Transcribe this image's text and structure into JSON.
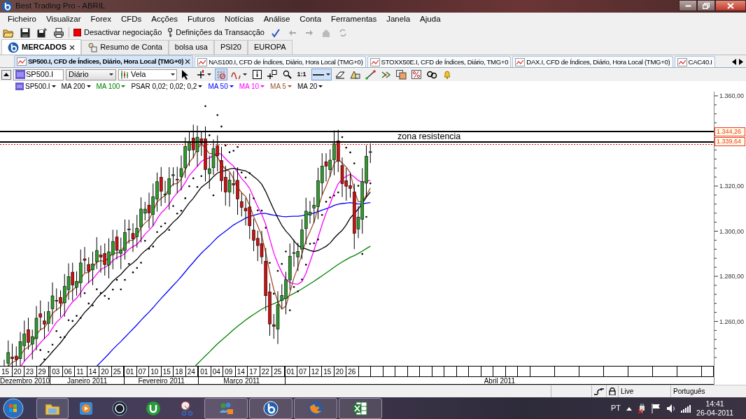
{
  "window": {
    "title": "Best Trading Pro - ABRIL"
  },
  "menu": [
    "Ficheiro",
    "Visualizar",
    "Forex",
    "CFDs",
    "Acções",
    "Futuros",
    "Notícias",
    "Análise",
    "Conta",
    "Ferramentas",
    "Janela",
    "Ajuda"
  ],
  "toolbar": {
    "trading_toggle": "Desactivar negociação",
    "transaction_settings": "Definições da Transacção"
  },
  "workspace_tabs": [
    {
      "label": "MERCADOS",
      "selected": true
    },
    {
      "label": "Resumo de Conta",
      "selected": false
    },
    {
      "label": "bolsa usa",
      "selected": false
    },
    {
      "label": "PSI20",
      "selected": false
    },
    {
      "label": "EUROPA",
      "selected": false
    }
  ],
  "chart_tabs": [
    {
      "label": "SP500.I, CFD de Índices, Diário, Hora Local (TMG+0)",
      "selected": true
    },
    {
      "label": "NAS100.I, CFD de Índices, Diário, Hora Local (TMG+0)",
      "selected": false
    },
    {
      "label": "STOXX50E.I, CFD de Índices, Diário, TMG+0",
      "selected": false
    },
    {
      "label": "DAX.I, CFD de Índices, Diário, Hora Local (TMG+0)",
      "selected": false
    },
    {
      "label": "CAC40.I",
      "selected": false
    }
  ],
  "chart_toolbar": {
    "symbol": "SP500.I",
    "period": "Diário",
    "chart_type": "Vela",
    "tools": [
      {
        "kind": "pointer",
        "selected": false
      },
      {
        "kind": "crosshair",
        "selected": false
      },
      {
        "kind": "grid",
        "selected": true
      },
      {
        "kind": "indicator",
        "selected": false
      },
      {
        "kind": "info",
        "selected": false
      },
      {
        "kind": "add",
        "selected": false
      },
      {
        "kind": "zoom",
        "selected": false
      },
      {
        "kind": "ratio",
        "label": "1:1",
        "selected": false
      },
      {
        "kind": "line",
        "selected": true
      },
      {
        "kind": "eraser",
        "selected": false
      },
      {
        "kind": "shapes",
        "selected": false
      },
      {
        "kind": "trendline",
        "selected": false
      },
      {
        "kind": "arrows",
        "selected": false
      },
      {
        "kind": "copy",
        "selected": false
      },
      {
        "kind": "percent",
        "selected": false
      },
      {
        "kind": "link",
        "selected": false
      },
      {
        "kind": "bell",
        "selected": false
      }
    ]
  },
  "legend": [
    {
      "label": "SP500.I",
      "color": "#000000"
    },
    {
      "label": "MA 200",
      "color": "#000000"
    },
    {
      "label": "MA 100",
      "color": "#008000"
    },
    {
      "label": "PSAR 0,02; 0,02; 0,2",
      "color": "#000000"
    },
    {
      "label": "MA 50",
      "color": "#0000ff"
    },
    {
      "label": "MA 10",
      "color": "#ff00ff"
    },
    {
      "label": "MA 5",
      "color": "#a0522d"
    },
    {
      "label": "MA 20",
      "color": "#000000"
    }
  ],
  "chart": {
    "annotation": "zona resistencia",
    "price_tags": [
      "1.344,26",
      "1.339,64"
    ],
    "price_labels": [
      "1.360,00",
      "1.320,00",
      "1.300,00",
      "1.280,00",
      "1.260,00"
    ]
  },
  "date_axis": {
    "months": [
      {
        "label": "Dezembro 2010",
        "days": [
          "15",
          "20",
          "23",
          "29"
        ]
      },
      {
        "label": "Janeiro 2011",
        "days": [
          "03",
          "06",
          "11",
          "14",
          "20",
          "25"
        ]
      },
      {
        "label": "Fevereiro 2011",
        "days": [
          "01",
          "07",
          "10",
          "15",
          "18",
          "24"
        ]
      },
      {
        "label": "Março 2011",
        "days": [
          "01",
          "04",
          "09",
          "14",
          "17",
          "22",
          "25"
        ]
      },
      {
        "label": "Abril 2011",
        "days": [
          "01",
          "07",
          "12",
          "15",
          "20",
          "26"
        ]
      }
    ]
  },
  "status_bar": {
    "connection": "Live",
    "language": "Português"
  },
  "taskbar": {
    "apps": [
      {
        "kind": "explorer",
        "running": true
      },
      {
        "kind": "media",
        "running": false
      },
      {
        "kind": "hp",
        "running": false
      },
      {
        "kind": "torrent",
        "running": false
      },
      {
        "kind": "snipping",
        "running": false
      },
      {
        "kind": "messenger",
        "running": true
      },
      {
        "kind": "trading",
        "running": true
      },
      {
        "kind": "firefox",
        "running": true
      },
      {
        "kind": "excel",
        "running": true
      }
    ],
    "language": "PT",
    "time": "14:41",
    "date": "26-04-2011"
  }
}
